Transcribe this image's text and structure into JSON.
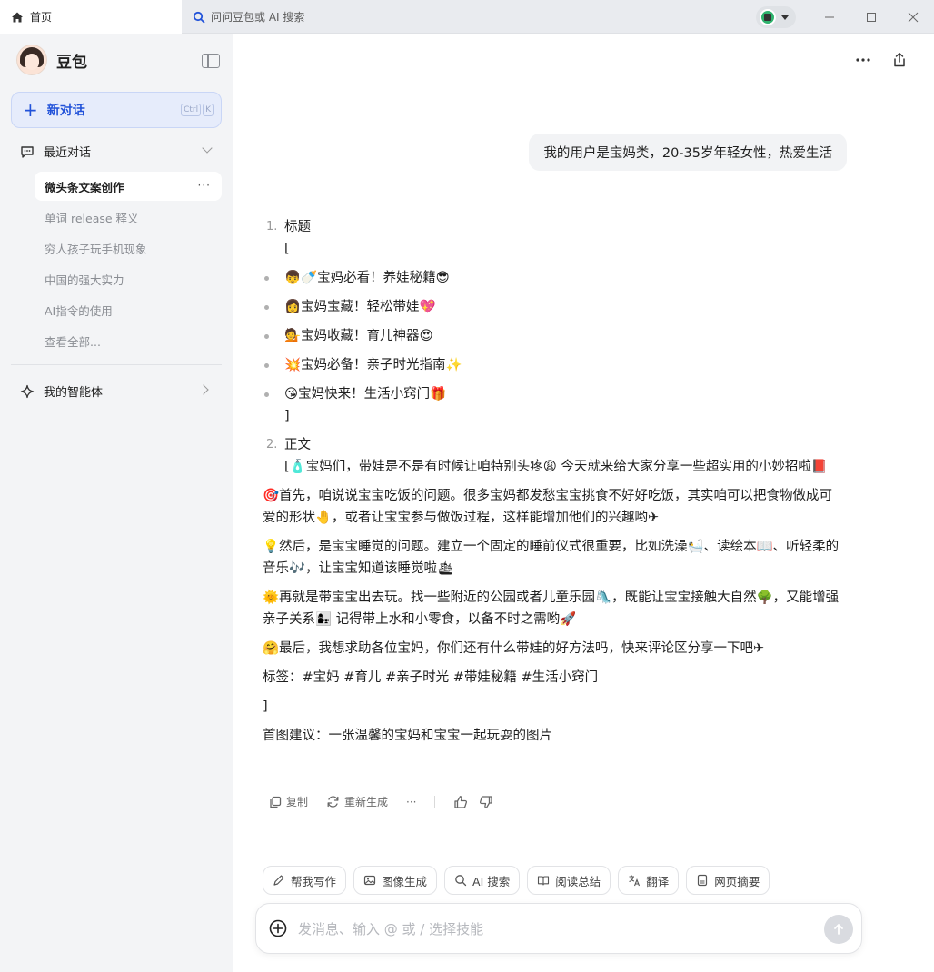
{
  "titlebar": {
    "home_tab": "首页",
    "search_tab": "问问豆包或 AI 搜索"
  },
  "sidebar": {
    "brand_name": "豆包",
    "new_chat_label": "新对话",
    "shortcut_keys": [
      "Ctrl",
      "K"
    ],
    "recent_label": "最近对话",
    "conversations": [
      "微头条文案创作",
      "单词 release 释义",
      "穷人孩子玩手机现象",
      "中国的强大实力",
      "AI指令的使用",
      "查看全部..."
    ],
    "agents_label": "我的智能体"
  },
  "chat": {
    "user_message": "我的用户是宝妈类，20-35岁年轻女性，热爱生活",
    "item1_num": "1.",
    "item1_title": "标题",
    "bracket_open": "[",
    "bracket_close": "]",
    "titles": [
      {
        "emoji": "👦🍼",
        "text": "宝妈必看！养娃秘籍",
        "tail": "😎"
      },
      {
        "emoji": "👩",
        "text": "宝妈宝藏！轻松带娃",
        "tail": "💖"
      },
      {
        "emoji": "💁",
        "text": "宝妈收藏！育儿神器",
        "tail": "😍"
      },
      {
        "emoji": "💥",
        "text": "宝妈必备！亲子时光指南",
        "tail": "✨"
      },
      {
        "emoji": "😘",
        "text": "宝妈快来！生活小窍门",
        "tail": "🎁"
      }
    ],
    "item2_num": "2.",
    "item2_title": "正文",
    "body_intro": "[🧴宝妈们，带娃是不是有时候让咱特别头疼😩 今天就来给大家分享一些超实用的小妙招啦📕",
    "paragraphs": [
      "🎯首先，咱说说宝宝吃饭的问题。很多宝妈都发愁宝宝挑食不好好吃饭，其实咱可以把食物做成可爱的形状🤚，或者让宝宝参与做饭过程，这样能增加他们的兴趣哟✈",
      "💡然后，是宝宝睡觉的问题。建立一个固定的睡前仪式很重要，比如洗澡🛀、读绘本📖、听轻柔的音乐🎶，让宝宝知道该睡觉啦🛳",
      "🌞再就是带宝宝出去玩。找一些附近的公园或者儿童乐园🛝，既能让宝宝接触大自然🌳，又能增强亲子关系👩‍👧 记得带上水和小零食，以备不时之需哟🚀",
      "🤗最后，我想求助各位宝妈，你们还有什么带娃的好方法吗，快来评论区分享一下吧✈"
    ],
    "tags": "标签：#宝妈 #育儿 #亲子时光 #带娃秘籍 #生活小窍门",
    "closing_bracket": "]",
    "image_suggestion": "首图建议：一张温馨的宝妈和宝宝一起玩耍的图片",
    "actions": {
      "copy": "复制",
      "regenerate": "重新生成",
      "more": "···"
    }
  },
  "skills": [
    "帮我写作",
    "图像生成",
    "AI 搜索",
    "阅读总结",
    "翻译",
    "网页摘要"
  ],
  "composer": {
    "placeholder": "发消息、输入 @ 或 / 选择技能"
  },
  "colors": {
    "accent": "#2152d9",
    "sidebar_bg": "#f3f4f6",
    "bubble_bg": "#f2f3f5"
  }
}
